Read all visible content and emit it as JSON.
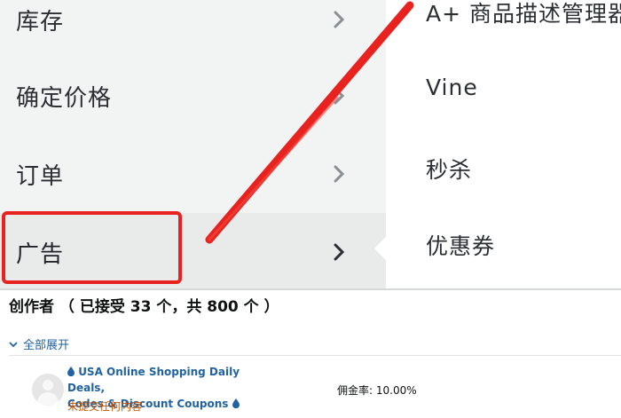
{
  "menu": {
    "items": [
      {
        "label": "库存"
      },
      {
        "label": "确定价格"
      },
      {
        "label": "订单"
      },
      {
        "label": "广告"
      }
    ],
    "submenu": [
      {
        "label": "A+ 商品描述管理器"
      },
      {
        "label": "Vine"
      },
      {
        "label": "秒杀"
      },
      {
        "label": "优惠券"
      }
    ],
    "highlight_color": "#e8231f"
  },
  "creators": {
    "title": "创作者 （ 已接受 33 个，共 800 个 ）",
    "expand_all": "全部展开",
    "card": {
      "channel_line1": "USA Online Shopping Daily Deals,",
      "channel_line2": "Codes & Discount Coupons",
      "status": "未提交任何内容",
      "commission": "佣金率: 10.00%"
    }
  }
}
